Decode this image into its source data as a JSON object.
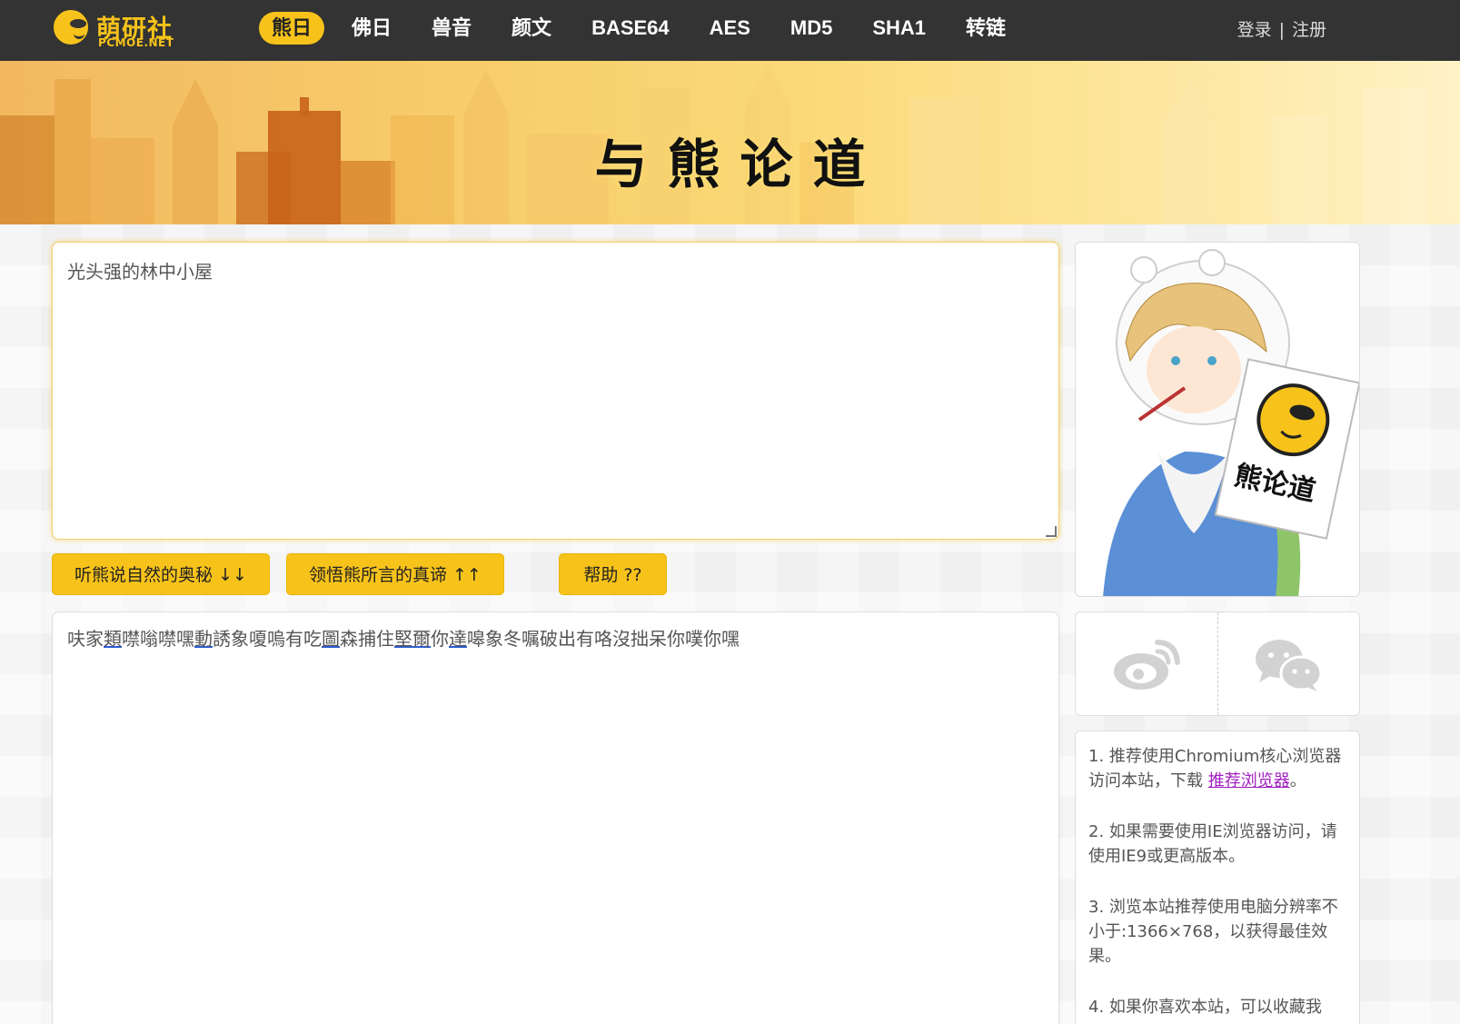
{
  "header": {
    "logo_cn": "萌研社",
    "logo_en": "PCMOE.NET",
    "nav": [
      "熊日",
      "佛日",
      "兽音",
      "颜文",
      "BASE64",
      "AES",
      "MD5",
      "SHA1",
      "转链"
    ],
    "active_index": 0,
    "login": "登录",
    "separator": "|",
    "register": "注册"
  },
  "banner": {
    "title": "与熊论道"
  },
  "input": {
    "value": "光头强的林中小屋"
  },
  "buttons": {
    "encode": "听熊说自然的奥秘 ↓↓",
    "decode": "领悟熊所言的真谛 ↑↑",
    "help": "帮助 ??"
  },
  "output": {
    "segments": [
      {
        "t": "呋家",
        "u": false
      },
      {
        "t": "類",
        "u": true
      },
      {
        "t": "噤嗡噤嘿",
        "u": false
      },
      {
        "t": "動",
        "u": true
      },
      {
        "t": "誘象嗄嗚有吃",
        "u": false
      },
      {
        "t": "圖",
        "u": true
      },
      {
        "t": "森捕住",
        "u": false
      },
      {
        "t": "堅爾",
        "u": true
      },
      {
        "t": "你",
        "u": false
      },
      {
        "t": "達",
        "u": true
      },
      {
        "t": "嗥象冬嘱破出有咯沒拙呆你噗你嘿",
        "u": false
      }
    ]
  },
  "sidebar": {
    "sign_text": "熊论道",
    "tips": [
      {
        "text": "1. 推荐使用Chromium核心浏览器访问本站，下载 ",
        "link": "推荐浏览器",
        "after": "。"
      },
      {
        "text": "2. 如果需要使用IE浏览器访问，请使用IE9或更高版本。"
      },
      {
        "text": "3. 浏览本站推荐使用电脑分辨率不小于:1366×768，以获得最佳效果。"
      },
      {
        "text": "4. 如果你喜欢本站，可以收藏我"
      }
    ]
  },
  "colors": {
    "accent": "#f7c31a",
    "topbar": "#333333",
    "link": "#a020c0"
  }
}
